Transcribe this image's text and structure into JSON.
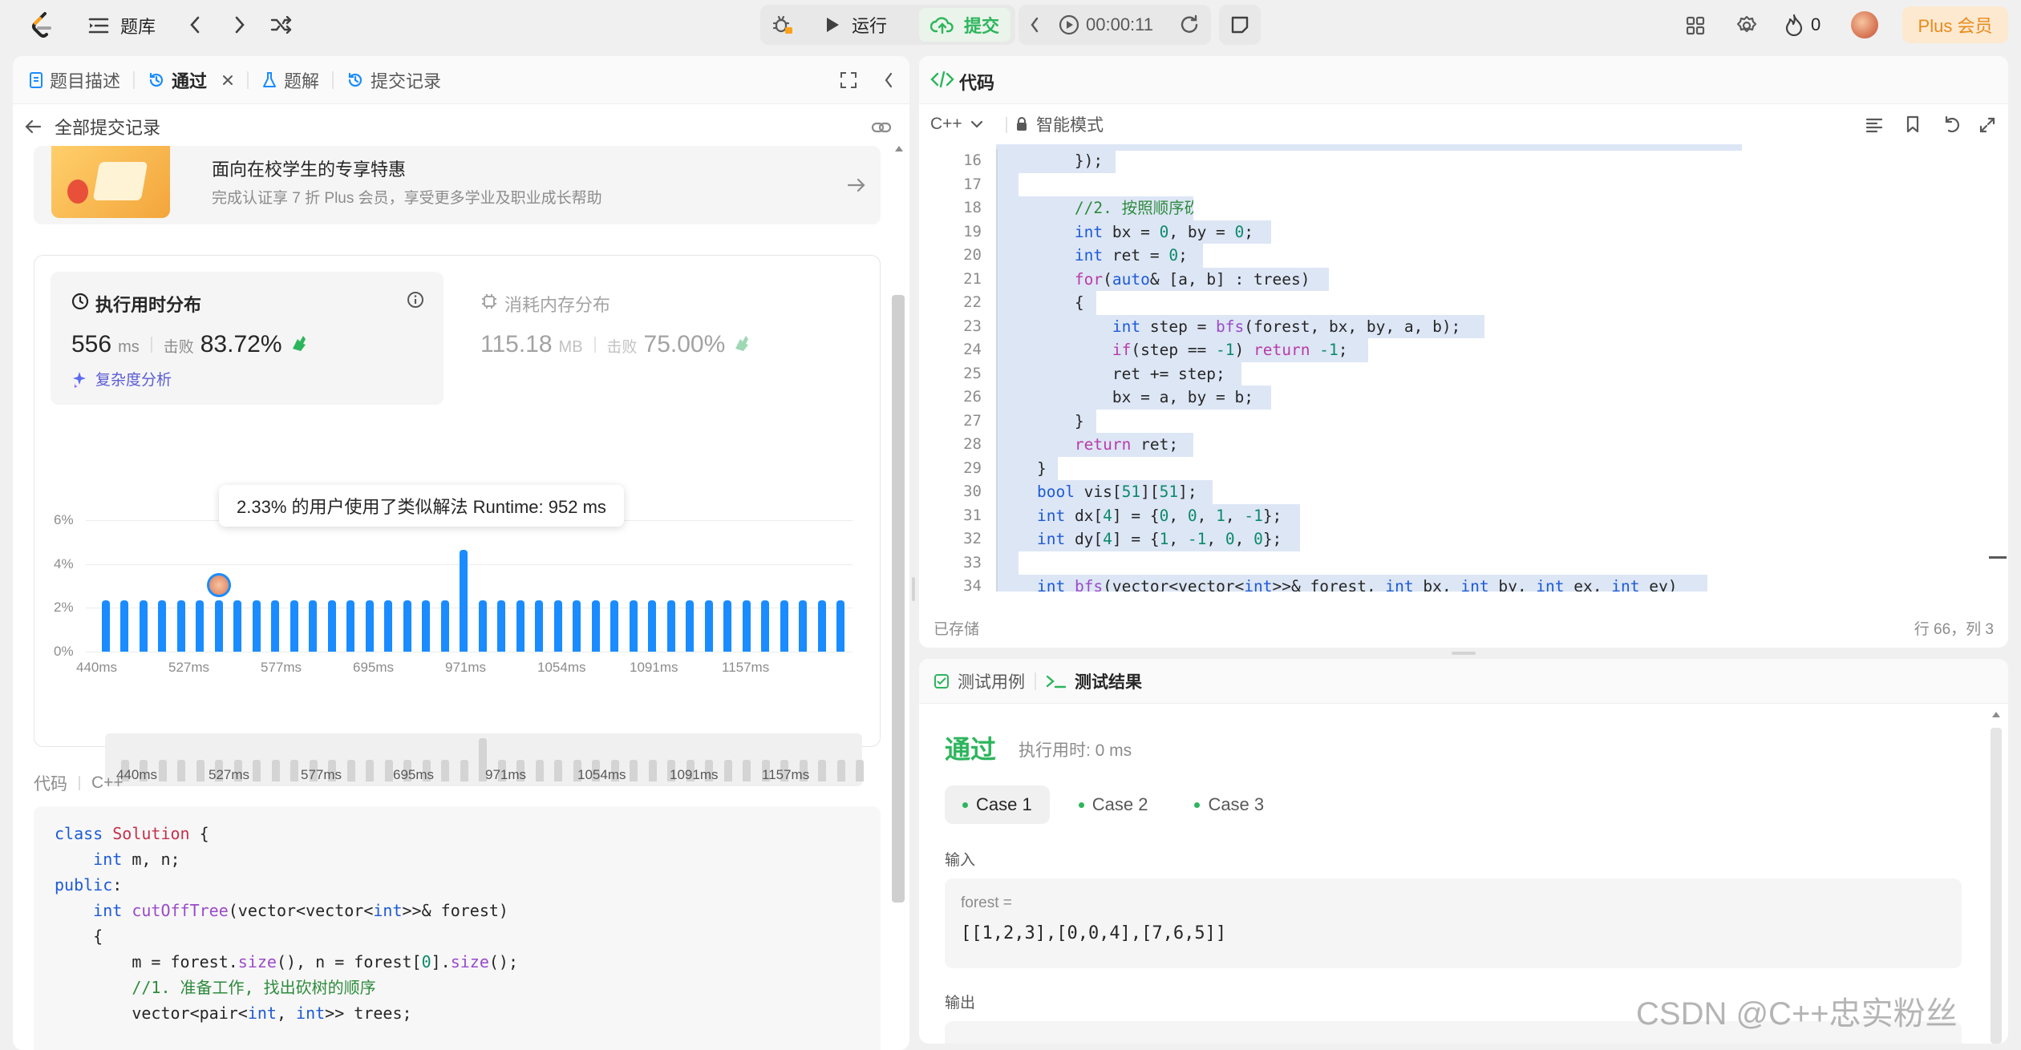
{
  "topbar": {
    "problem_bank": "题库",
    "run": "运行",
    "submit": "提交",
    "timer": "00:00:11",
    "streak": "0",
    "plus": "Plus 会员"
  },
  "left": {
    "tabs": [
      {
        "label": "题目描述"
      },
      {
        "label": "通过"
      },
      {
        "label": "题解"
      },
      {
        "label": "提交记录"
      }
    ],
    "back_label": "全部提交记录",
    "promo": {
      "title": "面向在校学生的专享特惠",
      "subtitle": "完成认证享 7 折 Plus 会员，享受更多学业及职业成长帮助"
    },
    "runtime": {
      "title": "执行用时分布",
      "value": "556",
      "unit": "ms",
      "beat_label": "击败",
      "beat": "83.72%",
      "complexity": "复杂度分析"
    },
    "memory": {
      "title": "消耗内存分布",
      "value": "115.18",
      "unit": "MB",
      "beat_label": "击败",
      "beat": "75.00%"
    },
    "tooltip": "2.33% 的用户使用了类似解法 Runtime: 952 ms",
    "code_label": "代码",
    "code_lang": "C++",
    "code": [
      "class Solution {",
      "    int m, n;",
      "public:",
      "    int cutOffTree(vector<vector<int>>& forest)",
      "    {",
      "        m = forest.size(), n = forest[0].size();",
      "        //1. 准备工作, 找出砍树的顺序",
      "        vector<pair<int, int>> trees;"
    ]
  },
  "chart_data": {
    "type": "bar",
    "title": "执行用时分布",
    "y_ticks": [
      "6%",
      "4%",
      "2%",
      "0%"
    ],
    "ylim": [
      0,
      6
    ],
    "x_tick_labels": [
      "440ms",
      "527ms",
      "577ms",
      "695ms",
      "971ms",
      "1054ms",
      "1091ms",
      "1157ms"
    ],
    "values": [
      2.33,
      2.33,
      2.33,
      2.33,
      2.33,
      2.33,
      2.33,
      2.33,
      2.33,
      2.33,
      2.33,
      2.33,
      2.33,
      2.33,
      2.33,
      2.33,
      2.33,
      2.33,
      2.33,
      4.65,
      2.33,
      2.33,
      2.33,
      2.33,
      2.33,
      2.33,
      2.33,
      2.33,
      2.33,
      2.33,
      2.33,
      2.33,
      2.33,
      2.33,
      2.33,
      2.33,
      2.33,
      2.33,
      2.33,
      2.33
    ],
    "highlight_index": 6,
    "tooltip_value": "2.33%",
    "tooltip_runtime": "952 ms",
    "bar_color": "#1a8cff"
  },
  "editor": {
    "title": "代码",
    "lang": "C++",
    "mode": "智能模式",
    "status": "已存储",
    "cursor": "行 66，列 3",
    "lines": [
      {
        "n": "16",
        "t": "        });"
      },
      {
        "n": "17",
        "t": ""
      },
      {
        "n": "18",
        "t": "        //2. 按照顺序砍树"
      },
      {
        "n": "19",
        "t": "        int bx = 0, by = 0;"
      },
      {
        "n": "20",
        "t": "        int ret = 0;"
      },
      {
        "n": "21",
        "t": "        for(auto& [a, b] : trees)"
      },
      {
        "n": "22",
        "t": "        {"
      },
      {
        "n": "23",
        "t": "            int step = bfs(forest, bx, by, a, b);"
      },
      {
        "n": "24",
        "t": "            if(step == -1) return -1;"
      },
      {
        "n": "25",
        "t": "            ret += step;"
      },
      {
        "n": "26",
        "t": "            bx = a, by = b;"
      },
      {
        "n": "27",
        "t": "        }"
      },
      {
        "n": "28",
        "t": "        return ret;"
      },
      {
        "n": "29",
        "t": "    }"
      },
      {
        "n": "30",
        "t": "    bool vis[51][51];"
      },
      {
        "n": "31",
        "t": "    int dx[4] = {0, 0, 1, -1};"
      },
      {
        "n": "32",
        "t": "    int dy[4] = {1, -1, 0, 0};"
      },
      {
        "n": "33",
        "t": ""
      },
      {
        "n": "34",
        "t": "    int bfs(vector<vector<int>>& forest, int bx, int by, int ex, int ey)"
      }
    ]
  },
  "results": {
    "tab_cases": "测试用例",
    "tab_result": "测试结果",
    "status": "通过",
    "runtime": "执行用时: 0 ms",
    "cases": [
      "Case 1",
      "Case 2",
      "Case 3"
    ],
    "input_label": "输入",
    "param_name": "forest =",
    "param_value": "[[1,2,3],[0,0,4],[7,6,5]]",
    "output_label": "输出"
  },
  "watermark": "CSDN @C++忠实粉丝"
}
